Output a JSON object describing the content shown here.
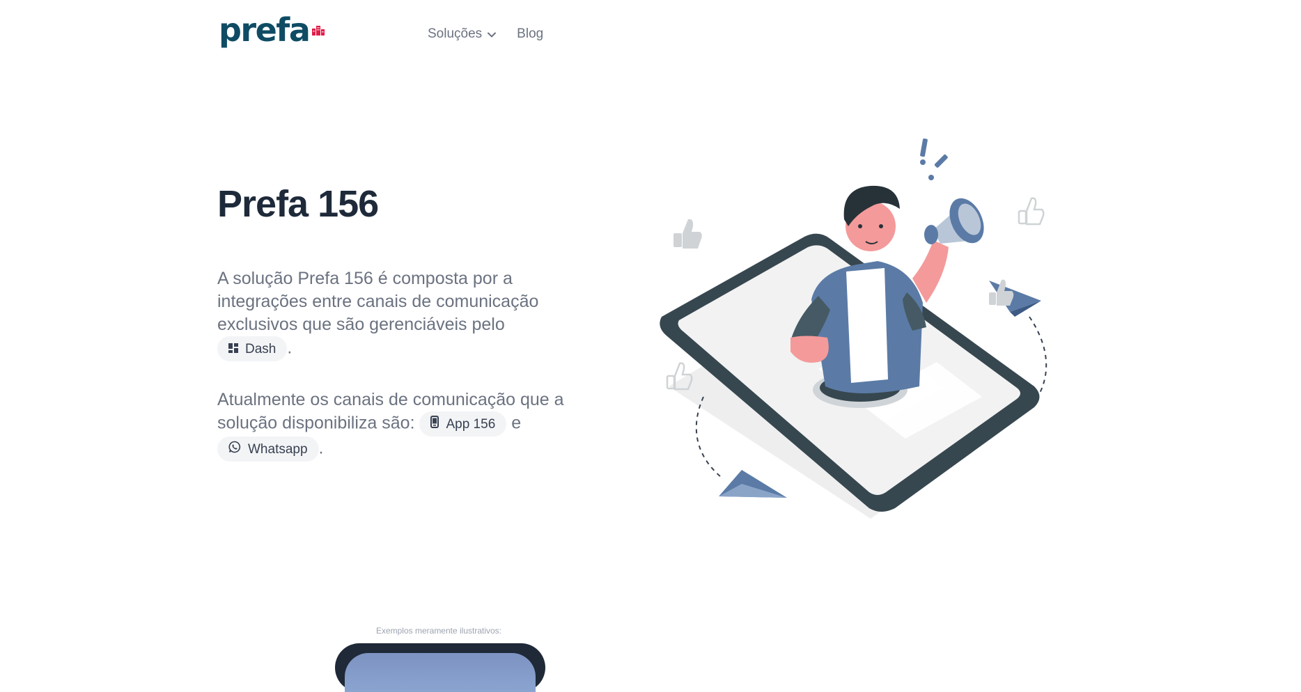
{
  "header": {
    "logo_text": "prefa",
    "nav": [
      {
        "label": "Soluções",
        "has_dropdown": true
      },
      {
        "label": "Blog",
        "has_dropdown": false
      }
    ]
  },
  "hero": {
    "title": "Prefa 156",
    "paragraph1": {
      "text": "A solução Prefa 156 é composta por a integrações entre canais de comunicação exclusivos que são gerenciáveis pelo",
      "chip": {
        "label": "Dash",
        "icon": "dashboard-icon"
      },
      "end": "."
    },
    "paragraph2": {
      "text": "Atualmente os canais de comunicação que a solução disponibiliza são:",
      "chip1": {
        "label": "App 156",
        "icon": "phone-icon"
      },
      "connector": "e",
      "chip2": {
        "label": "Whatsapp",
        "icon": "whatsapp-icon"
      },
      "end": "."
    }
  },
  "examples": {
    "note": "Exemplos meramente ilustrativos:"
  },
  "colors": {
    "brand": "#0f4c64",
    "accent_red": "#e11d48",
    "text_muted": "#6b7280",
    "title": "#1e2a3a",
    "chip_bg": "#f3f4f6"
  }
}
